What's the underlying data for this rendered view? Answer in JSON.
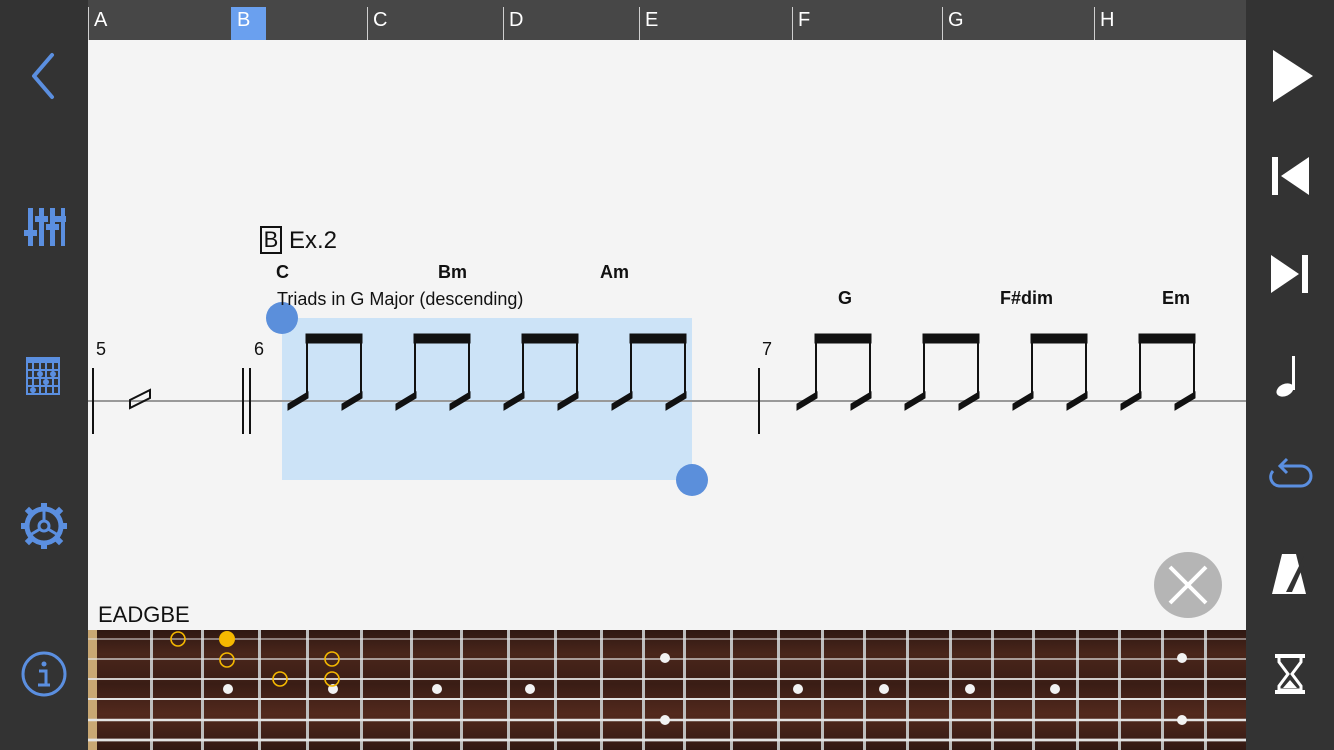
{
  "timeline": {
    "sections": [
      {
        "label": "A"
      },
      {
        "label": "B"
      },
      {
        "label": "C"
      },
      {
        "label": "D"
      },
      {
        "label": "E"
      },
      {
        "label": "F"
      },
      {
        "label": "G"
      },
      {
        "label": "H"
      }
    ],
    "active": "B"
  },
  "score": {
    "rehearsal_mark": "B",
    "section_title": "Ex.2",
    "text_annotation": "Triads in G Major (descending)",
    "measures": [
      {
        "number": "5"
      },
      {
        "number": "6"
      },
      {
        "number": "7"
      }
    ],
    "chords": [
      {
        "label": "C"
      },
      {
        "label": "Bm"
      },
      {
        "label": "Am"
      },
      {
        "label": "G"
      },
      {
        "label": "F#dim"
      },
      {
        "label": "Em"
      }
    ]
  },
  "fretboard": {
    "tuning": "EADGBE"
  },
  "colors": {
    "accent": "#5b8fe0",
    "selection": "#cce3f7",
    "handle": "#5b8fdb",
    "active_section": "#6aa0ef",
    "highlight_note": "#f5b800",
    "sidebar_bg": "#333333",
    "score_bg": "#f4f4f4"
  },
  "icons": {
    "left": [
      "back-icon",
      "mixer-icon",
      "chord-grid-icon",
      "settings-icon",
      "info-icon"
    ],
    "right": [
      "play-icon",
      "skip-start-icon",
      "skip-end-icon",
      "note-icon",
      "loop-icon",
      "metronome-icon",
      "timer-icon",
      "close-icon"
    ]
  }
}
